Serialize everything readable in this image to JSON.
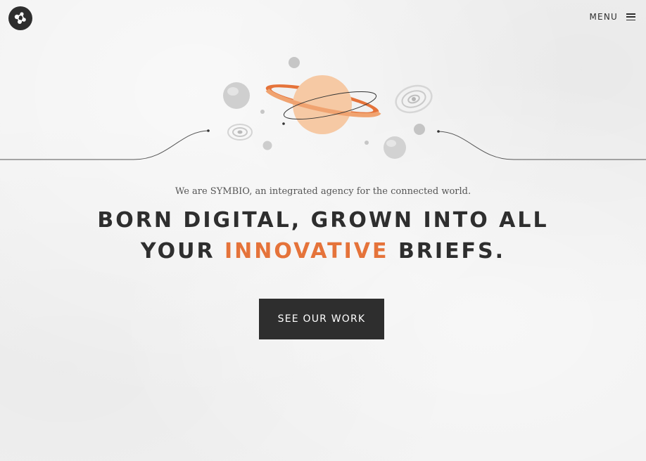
{
  "header": {
    "logo_icon": "symbio-molecule-icon",
    "menu_label": "MENU",
    "menu_icon": "hamburger-icon"
  },
  "hero": {
    "illustration": "space-planet-illustration",
    "tagline": "We are SYMBIO, an integrated agency for the connected world.",
    "headline_line1": "BORN DIGITAL, GROWN INTO ALL",
    "headline_line2_start": "YOUR",
    "headline_line2_accent": "INNOVATIVE",
    "headline_line2_end": "BRIEFS.",
    "cta_label": "SEE OUR WORK"
  },
  "colors": {
    "accent": "#e5733a",
    "dark": "#2e2e2e",
    "background": "#f1f1f1",
    "planet": "#f6c9a4"
  }
}
